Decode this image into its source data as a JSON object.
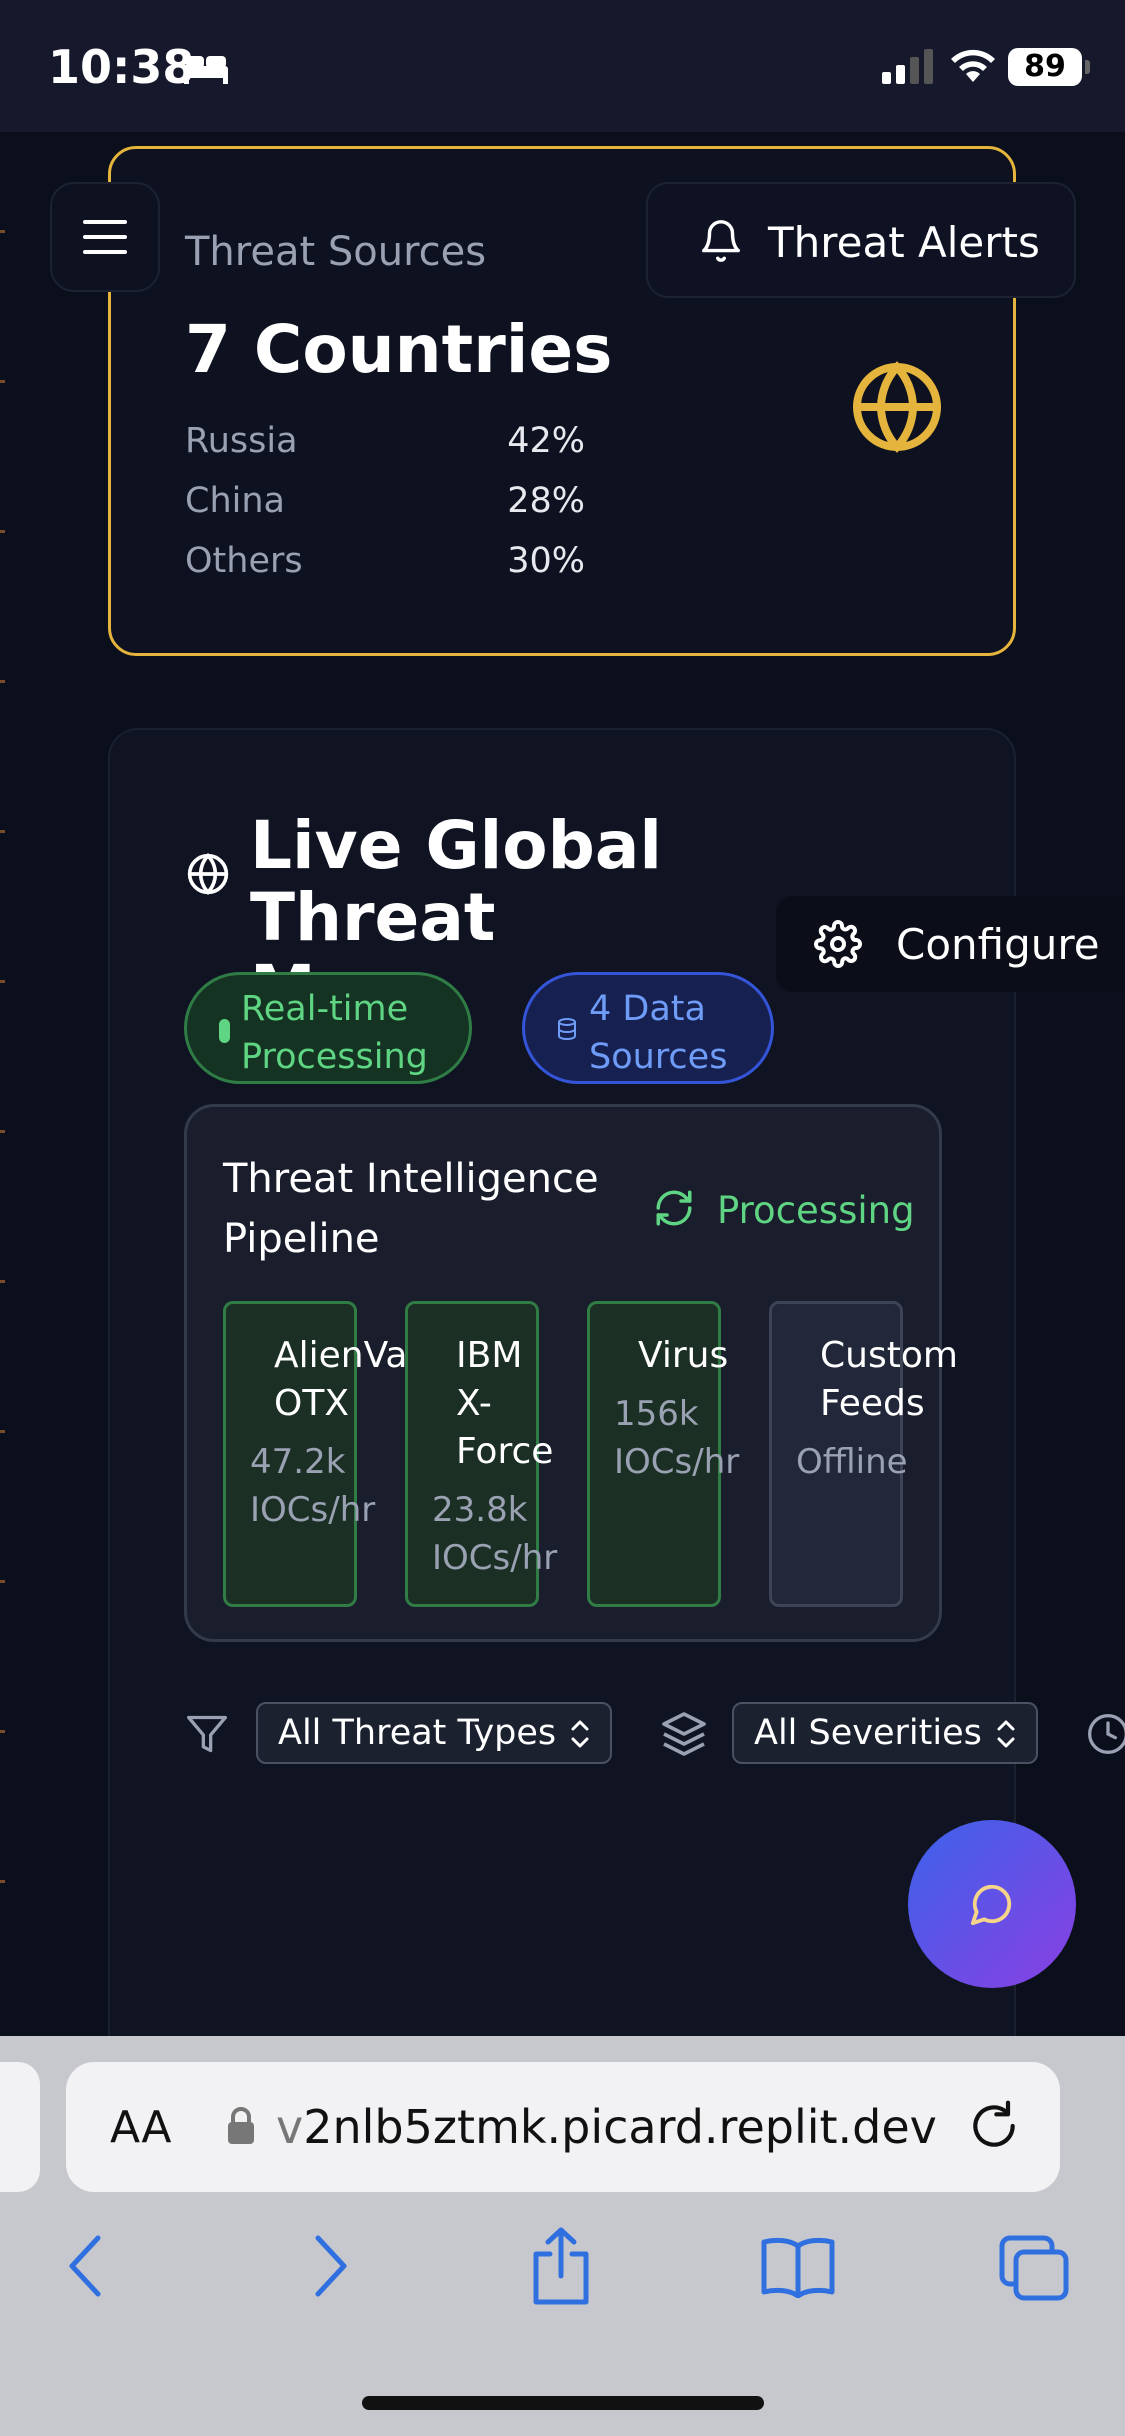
{
  "status_bar": {
    "time": "10:38",
    "battery": "89"
  },
  "header": {
    "alerts_label": "Threat Alerts"
  },
  "threat_sources": {
    "label": "Threat Sources",
    "value": "7 Countries",
    "rows": [
      {
        "country": "Russia",
        "pct": "42%"
      },
      {
        "country": "China",
        "pct": "28%"
      },
      {
        "country": "Others",
        "pct": "30%"
      }
    ]
  },
  "map_card": {
    "title": "Live Global Threat Map",
    "configure_label": "Configure",
    "badges": {
      "realtime": "Real-time Processing",
      "data_sources": "4 Data Sources"
    },
    "pipeline": {
      "title": "Threat Intelligence Pipeline",
      "status": "Processing",
      "feeds": [
        {
          "name": "AlienVault OTX",
          "rate": "47.2k IOCs/hr",
          "status": "online"
        },
        {
          "name": "IBM X-Force",
          "rate": "23.8k IOCs/hr",
          "status": "online"
        },
        {
          "name": "VirusTotal",
          "rate": "156k IOCs/hr",
          "status": "online"
        },
        {
          "name": "Custom Feeds",
          "rate": "Offline",
          "status": "offline"
        }
      ]
    },
    "filters": {
      "threat_type": "All Threat Types",
      "severity": "All Severities"
    }
  },
  "browser": {
    "url_prefix": "v",
    "url": "2nlb5ztmk.picard.replit.dev",
    "aa_label": "AA"
  },
  "colors": {
    "accent_gold": "#e5b43c",
    "success_green": "#5fd482",
    "info_blue": "#6f9cf6"
  }
}
